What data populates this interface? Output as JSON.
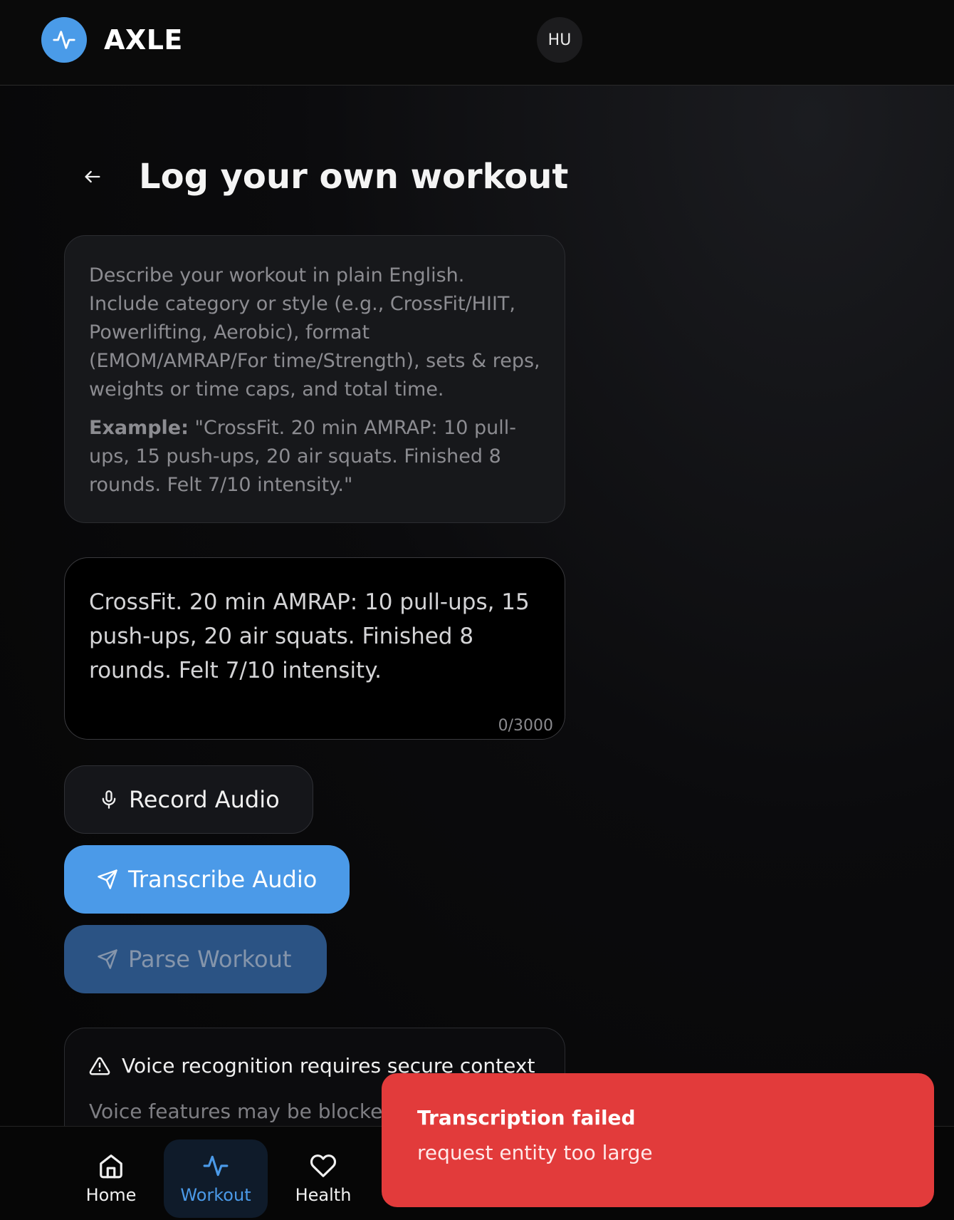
{
  "header": {
    "brand": "AXLE",
    "avatar_initials": "HU",
    "logo_icon": "pulse-icon"
  },
  "page": {
    "title": "Log your own workout",
    "back_icon": "arrow-left-icon"
  },
  "info": {
    "description": "Describe your workout in plain English. Include category or style (e.g., CrossFit/HIIT, Powerlifting, Aerobic), format (EMOM/AMRAP/For time/Strength), sets & reps, weights or time caps, and total time.",
    "example_label": "Example:",
    "example_text": " \"CrossFit. 20 min AMRAP: 10 pull-ups, 15 push-ups, 20 air squats. Finished 8 rounds. Felt 7/10 intensity.\""
  },
  "workout_input": {
    "value": "CrossFit. 20 min AMRAP: 10 pull-ups, 15 push-ups, 20 air squats. Finished 8 rounds. Felt 7/10 intensity.",
    "counter": "0/3000"
  },
  "actions": {
    "record_label": "Record Audio",
    "record_icon": "microphone-icon",
    "transcribe_label": "Transcribe Audio",
    "transcribe_icon": "send-icon",
    "parse_label": "Parse Workout",
    "parse_icon": "send-icon"
  },
  "warning": {
    "title": "Voice recognition requires secure context",
    "description": "Voice features may be blocked i",
    "icon": "warning-triangle-icon"
  },
  "nav": {
    "items": [
      {
        "label": "Home",
        "icon": "home-icon"
      },
      {
        "label": "Workout",
        "icon": "pulse-icon",
        "active": true
      },
      {
        "label": "Health",
        "icon": "heart-icon"
      }
    ]
  },
  "toast": {
    "title": "Transcription failed",
    "message": "request entity too large"
  },
  "colors": {
    "accent": "#4b9ae8",
    "error": "#e23b3b",
    "background": "#050505"
  }
}
